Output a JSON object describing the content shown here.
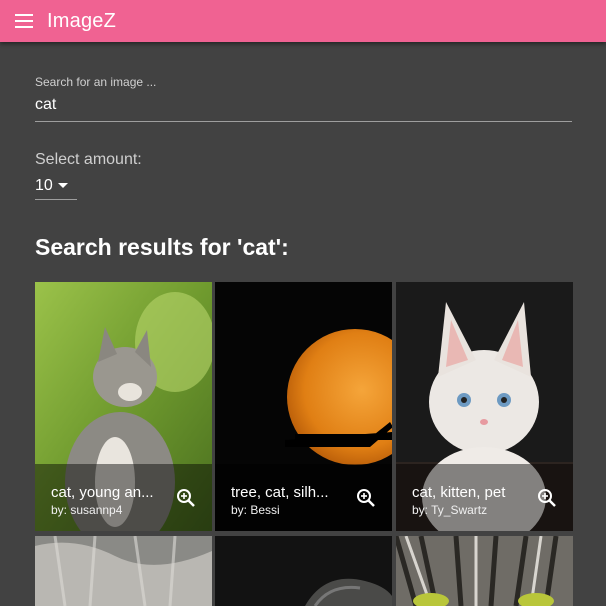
{
  "app": {
    "title": "ImageZ"
  },
  "search": {
    "label": "Search for an image ...",
    "value": "cat"
  },
  "amount": {
    "label": "Select amount:",
    "value": "10"
  },
  "results": {
    "heading": "Search results for 'cat':",
    "items": [
      {
        "title": "cat, young animal, curious",
        "title_display": "cat, young an...",
        "author": "by: susannp4"
      },
      {
        "title": "tree, cat, silhouette",
        "title_display": "tree, cat, silh...",
        "author": "by: Bessi"
      },
      {
        "title": "cat, kitten, pet",
        "title_display": "cat, kitten, pet",
        "author": "by: Ty_Swartz"
      }
    ]
  },
  "colors": {
    "appbar": "#f06292",
    "background": "#424242"
  }
}
